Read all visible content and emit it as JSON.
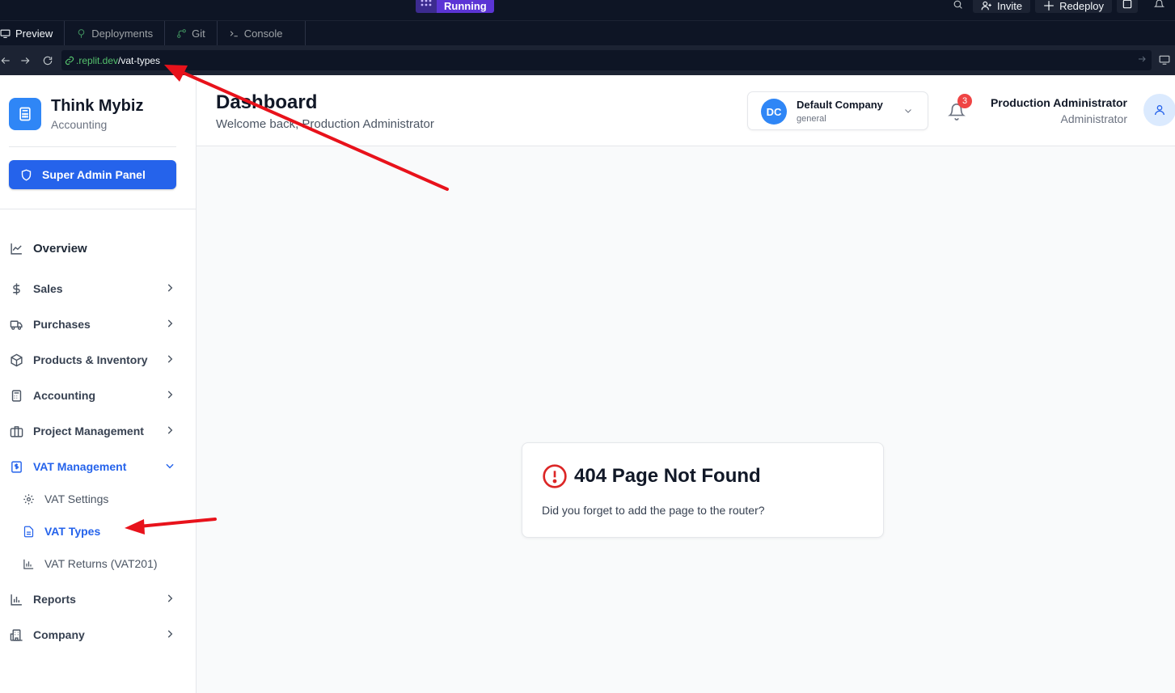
{
  "replit": {
    "status": "Running",
    "invite_label": "Invite",
    "redeploy_label": "Redeploy",
    "tabs": [
      {
        "label": "Preview",
        "icon": "monitor-icon"
      },
      {
        "label": "Deployments",
        "icon": "deployments-icon"
      },
      {
        "label": "Git",
        "icon": "git-icon"
      },
      {
        "label": "Console",
        "icon": "terminal-icon"
      }
    ],
    "url_host": ".replit.dev",
    "url_path": "/vat-types"
  },
  "brand": {
    "name": "Think Mybiz",
    "subtitle": "Accounting",
    "super_admin_label": "Super Admin Panel"
  },
  "sidebar": {
    "items": [
      {
        "label": "Overview",
        "icon": "chart-line-icon"
      },
      {
        "label": "Sales",
        "icon": "dollar-icon"
      },
      {
        "label": "Purchases",
        "icon": "truck-icon"
      },
      {
        "label": "Products & Inventory",
        "icon": "package-icon"
      },
      {
        "label": "Accounting",
        "icon": "calculator-icon"
      },
      {
        "label": "Project Management",
        "icon": "briefcase-icon"
      },
      {
        "label": "VAT Management",
        "icon": "receipt-icon",
        "expanded": true
      },
      {
        "label": "Reports",
        "icon": "bar-chart-icon"
      },
      {
        "label": "Company",
        "icon": "building-icon"
      }
    ],
    "vat_sub": [
      {
        "label": "VAT Settings",
        "icon": "gear-icon"
      },
      {
        "label": "VAT Types",
        "icon": "file-text-icon",
        "active": true
      },
      {
        "label": "VAT Returns (VAT201)",
        "icon": "bar-chart-icon"
      }
    ]
  },
  "header": {
    "title": "Dashboard",
    "subtitle": "Welcome back, Production Administrator",
    "company_initials": "DC",
    "company_name": "Default Company",
    "company_type": "general",
    "notification_count": "3",
    "user_name": "Production Administrator",
    "user_role": "Administrator"
  },
  "notfound": {
    "title": "404 Page Not Found",
    "description": "Did you forget to add the page to the router?"
  },
  "colors": {
    "accent": "#2563eb",
    "brand": "#2f86f6",
    "error": "#dc2626",
    "annotation": "#e8121b"
  }
}
